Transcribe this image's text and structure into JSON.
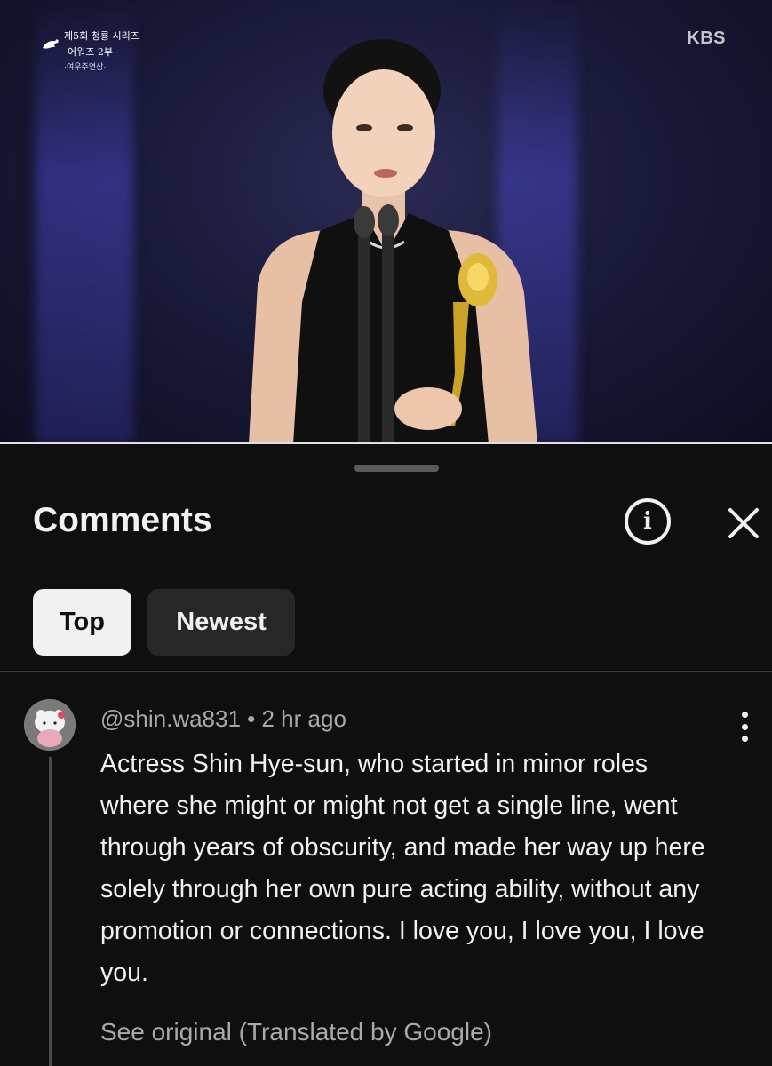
{
  "video": {
    "broadcast_logo": {
      "line1": "제5회 청룡 시리즈",
      "line2": "어워즈 2부",
      "line3": "·여우주연상·"
    },
    "channel_logo": "KBS"
  },
  "comments_panel": {
    "title": "Comments",
    "info_icon": "info-icon",
    "close_icon": "close-icon",
    "sort_chips": [
      {
        "label": "Top",
        "selected": true
      },
      {
        "label": "Newest",
        "selected": false
      }
    ]
  },
  "comment": {
    "handle": "@shin.wa831",
    "separator": " • ",
    "time": "2 hr ago",
    "text": "Actress Shin Hye-sun, who started in minor roles where she might or might not get a single line, went through years of obscurity, and made her way up here solely through her own pure acting ability, without any promotion or connections. I love you, I love you, I love you.",
    "see_original": "See original (Translated by Google)",
    "more_icon": "more-vertical-icon"
  },
  "colors": {
    "background": "#0f0f0f",
    "text_primary": "#f1f1f1",
    "text_secondary": "#aaaaaa",
    "chip_selected_bg": "#f1f1f1",
    "chip_bg": "#272727"
  }
}
